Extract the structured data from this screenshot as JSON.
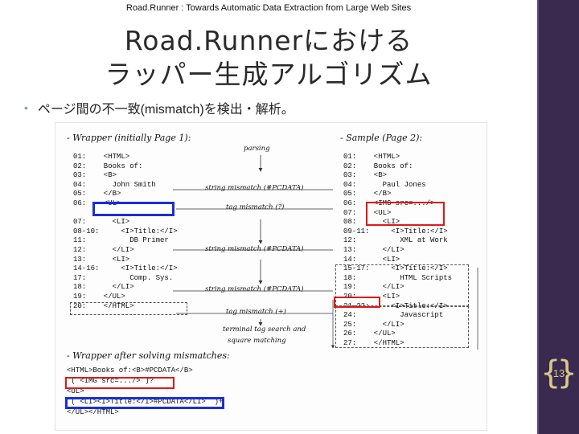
{
  "header": {
    "caption": "Road.Runner : Towards Automatic Data Extraction from Large Web Sites"
  },
  "slide": {
    "title_line1": "Road.Runnerにおける",
    "title_line2": "ラッパー生成アルゴリズム",
    "bullet": "ページ間の不一致(mismatch)を検出・解析。",
    "page_number": "13"
  },
  "figure": {
    "wrapper_title": "- Wrapper (initially Page 1):",
    "sample_title": "- Sample (Page 2):",
    "after_title": "- Wrapper after solving mismatches:",
    "left_code": "01:    <HTML>\n02:    Books of:\n03:    <B>\n04:      John Smith\n05:    </B>\n06:    <UL>\n\n07:      <LI>\n08-10:     <I>Title:</I>\n11:          DB Primer\n12:      </LI>\n13:      <LI>\n14-16:     <I>Title:</I>\n17:          Comp. Sys.\n18:      </LI>\n19:    </UL>\n20:    </HTML>",
    "right_code": "01:    <HTML>\n02:    Books of:\n03:    <B>\n04:      Paul Jones\n05:    </B>\n06:    <IMG src=.../>\n07:    <UL>\n08:      <LI>\n09-11:     <I>Title:</I>\n12:          XML at Work\n13:      </LI>\n14:      <LI>\n15-17:     <I>Title:</I>\n18:          HTML Scripts\n19:      </LI>\n20:      <LI>\n21-23:     <I>Title:</I>\n24:          Javascript\n25:      </LI>\n26:    </UL>\n27:    </HTML>",
    "labels": {
      "parsing": "parsing",
      "string1": "string mismatch (#PCDATA)",
      "tag1": "tag mismatch (?)",
      "string2": "string mismatch (#PCDATA)",
      "string3": "string mismatch (#PCDATA)",
      "tag2": "tag mismatch (+)",
      "terminal1": "terminal tag search and",
      "terminal2": "square matching"
    },
    "merged_code": "<HTML>Books of:<B>#PCDATA</B>\n ( <IMG src=.../> )?\n<UL>\n ( <LI><I>Title:</I>#PCDATA</LI>  )+\n</UL></HTML>"
  }
}
